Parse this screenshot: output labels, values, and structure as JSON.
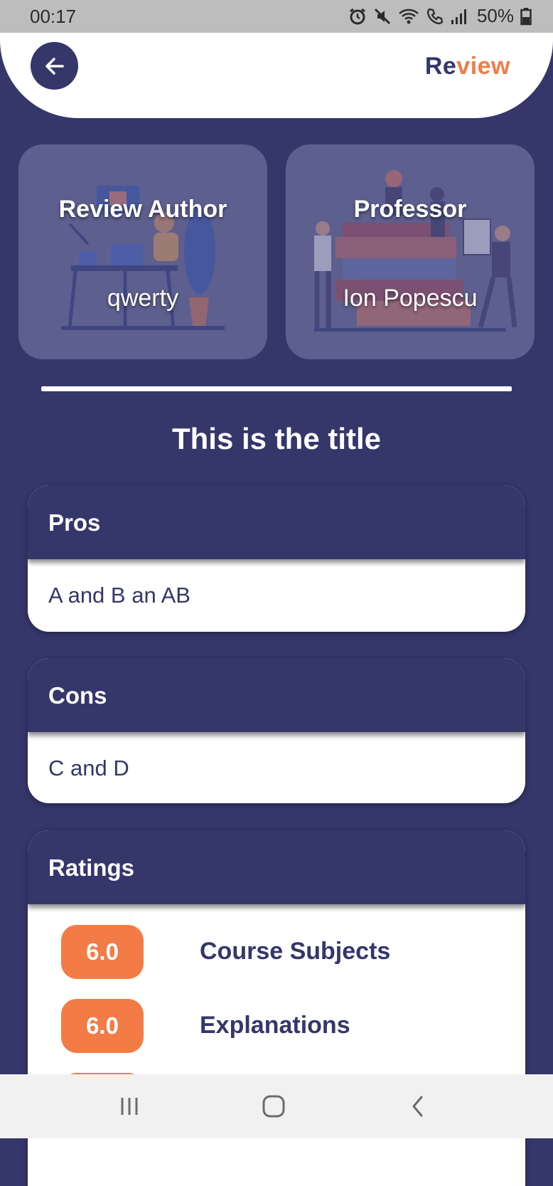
{
  "status_bar": {
    "time": "00:17",
    "battery": "50%",
    "icons": [
      "alarm-icon",
      "mute-icon",
      "wifi-icon",
      "call-icon",
      "signal-icon",
      "battery-icon"
    ]
  },
  "header": {
    "title_part1": "Re",
    "title_part2": "view",
    "back_icon": "arrow-left-icon",
    "colors": {
      "primary": "#35366a",
      "accent": "#f37b45"
    }
  },
  "author_card": {
    "label": "Review Author",
    "value": "qwerty"
  },
  "professor_card": {
    "label": "Professor",
    "value": "Ion Popescu"
  },
  "review": {
    "title": "This is the title",
    "pros": {
      "header": "Pros",
      "text": "A and B an AB"
    },
    "cons": {
      "header": "Cons",
      "text": "C and D"
    },
    "ratings": {
      "header": "Ratings",
      "items": [
        {
          "score": "6.0",
          "label": "Course Subjects"
        },
        {
          "score": "6.0",
          "label": "Explanations"
        }
      ]
    }
  },
  "nav_bar": {
    "buttons": [
      "recent-apps-icon",
      "home-icon",
      "back-icon"
    ]
  }
}
